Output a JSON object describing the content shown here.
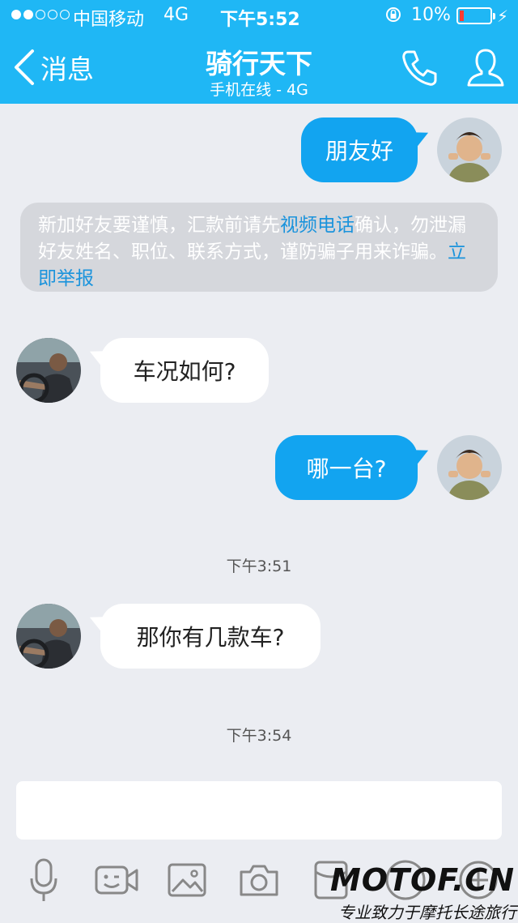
{
  "status_bar": {
    "carrier": "中国移动",
    "network": "4G",
    "time": "下午5:52",
    "battery": "10%"
  },
  "header": {
    "back_label": "消息",
    "title": "骑行天下",
    "subtitle": "手机在线 - 4G"
  },
  "messages": [
    {
      "side": "out",
      "text": "朋友好"
    },
    {
      "side": "in",
      "text": "车况如何?"
    },
    {
      "side": "out",
      "text": "哪一台?"
    },
    {
      "side": "in",
      "text": "那你有几款车?"
    }
  ],
  "notice": {
    "text1": "新加好友要谨慎，汇款前请先",
    "link1": "视频电话",
    "text2": "确认，勿泄漏好友姓名、职位、联系方式，谨防骗子用来诈骗。",
    "link2": "立即举报"
  },
  "timestamps": [
    "下午3:51",
    "下午3:54"
  ],
  "watermark": {
    "logo": "MOTOF.CN",
    "tagline": "专业致力于摩托长途旅行"
  },
  "colors": {
    "header_bg": "#1fb7f5",
    "outgoing_bubble": "#12a4f0",
    "link": "#1a93dc"
  }
}
